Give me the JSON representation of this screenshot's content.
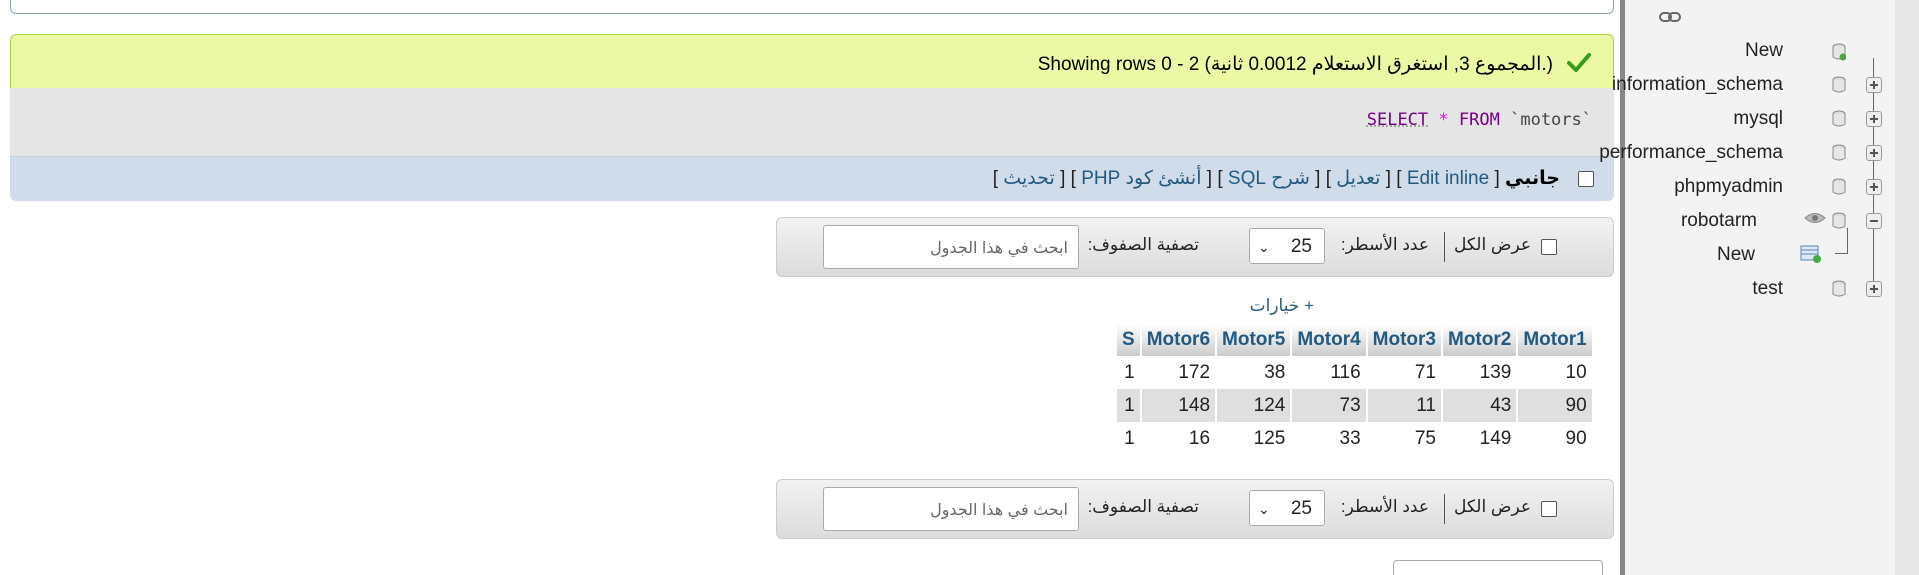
{
  "result": {
    "message": "Showing rows 0 - 2 (المجموع 3, استغرق الاستعلام 0.0012 ثانية.)",
    "query": {
      "select_kw": "SELECT",
      "star": "*",
      "from_kw": "FROM",
      "table": "`motors`"
    }
  },
  "links": {
    "inline": "جانبي",
    "edit_inline": "Edit inline",
    "edit": "تعديل",
    "explain": "شرح SQL",
    "create_php": "أنشئ كود PHP",
    "refresh": "تحديث",
    "open": "[",
    "close": "]"
  },
  "nav": {
    "show_all": "عرض الكل",
    "rows_label": "عدد الأسطر:",
    "rows_value": "25",
    "filter_label": "تصفية الصفوف:",
    "search_placeholder": "ابحث في هذا الجدول"
  },
  "options_link": "+ خيارات",
  "table": {
    "columns": [
      "Motor1",
      "Motor2",
      "Motor3",
      "Motor4",
      "Motor5",
      "Motor6",
      "S"
    ],
    "rows": [
      [
        "10",
        "139",
        "71",
        "116",
        "38",
        "172",
        "1"
      ],
      [
        "90",
        "43",
        "11",
        "73",
        "124",
        "148",
        "1"
      ],
      [
        "90",
        "149",
        "75",
        "33",
        "125",
        "16",
        "1"
      ]
    ]
  },
  "sidebar": {
    "items": [
      {
        "label": "New",
        "icon": "new-db-icon"
      },
      {
        "label": "information_schema",
        "icon": "database-icon"
      },
      {
        "label": "mysql",
        "icon": "database-icon"
      },
      {
        "label": "performance_schema",
        "icon": "database-icon"
      },
      {
        "label": "phpmyadmin",
        "icon": "database-icon"
      },
      {
        "label": "robotarm",
        "icon": "database-icon"
      },
      {
        "label": "New",
        "icon": "new-table-icon"
      },
      {
        "label": "test",
        "icon": "database-icon"
      }
    ]
  },
  "colors": {
    "success_bg": "#ebf8a4",
    "link": "#235a81",
    "sql_keyword": "#770088"
  }
}
